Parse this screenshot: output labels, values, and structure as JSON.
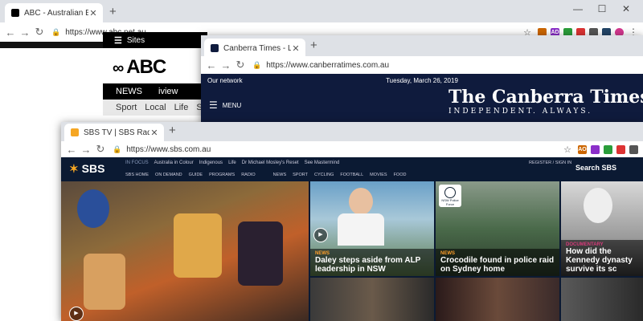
{
  "abc_window": {
    "tab_title": "ABC - Australian Broadcasting...",
    "url": "https://www.abc.net.au",
    "sites_label": "Sites",
    "logo_text": "ABC",
    "nav": [
      "NEWS",
      "iview"
    ],
    "subnav": [
      "Sport",
      "Local",
      "Life",
      "S"
    ]
  },
  "canberra_window": {
    "tab_title": "Canberra Times - Local Canb",
    "url": "https://www.canberratimes.com.au",
    "our_network": "Our network",
    "date": "Tuesday, March 26, 2019",
    "menu_label": "MENU",
    "masthead": "The Canberra Times",
    "tagline": "INDEPENDENT. ALWAYS."
  },
  "sbs_window": {
    "tab_title": "SBS TV | SBS Radio | SBS On D",
    "url": "https://www.sbs.com.au",
    "logo_text": "SBS",
    "in_focus_label": "IN FOCUS",
    "focus_links": [
      "Australia in Colour",
      "Indigenous",
      "Life",
      "Dr Michael Mosley's Reset",
      "See Mastermind"
    ],
    "nav_left": [
      "SBS HOME",
      "ON DEMAND",
      "GUIDE",
      "PROGRAMS",
      "RADIO"
    ],
    "nav_right": [
      "NEWS",
      "SPORT",
      "CYCLING",
      "FOOTBALL",
      "MOVIES",
      "FOOD"
    ],
    "register": "REGISTER / SIGN IN",
    "search_label": "Search SBS",
    "tiles": [
      {
        "tag": "NEWS",
        "headline": "Daley steps aside from ALP leadership in NSW"
      },
      {
        "tag": "NEWS",
        "headline": "Crocodile found in police raid on Sydney home"
      },
      {
        "tag": "DOCUMENTARY",
        "headline": "How did the Kennedy dynasty survive its sc"
      }
    ],
    "badge_text": "NSW Police Force"
  },
  "ext_icons": [
    "AO",
    "AD"
  ]
}
